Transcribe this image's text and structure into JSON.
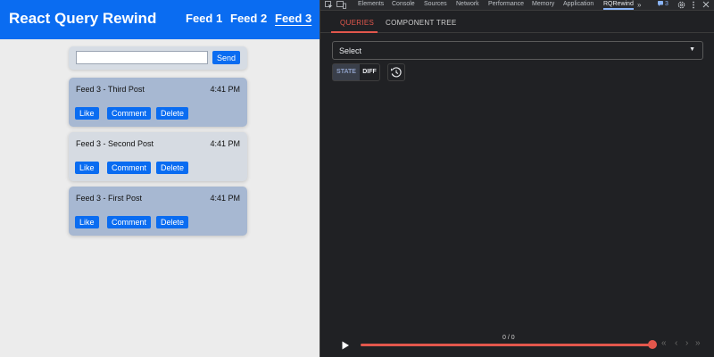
{
  "app": {
    "title": "React Query Rewind",
    "nav": [
      {
        "label": "Feed 1",
        "active": false
      },
      {
        "label": "Feed 2",
        "active": false
      },
      {
        "label": "Feed 3",
        "active": true
      }
    ],
    "composer": {
      "value": "",
      "send_label": "Send"
    },
    "posts": [
      {
        "title": "Feed 3 - Third Post",
        "time": "4:41 PM",
        "liked": true,
        "buttons": [
          "Like",
          "Comment",
          "Delete"
        ]
      },
      {
        "title": "Feed 3 - Second Post",
        "time": "4:41 PM",
        "liked": false,
        "buttons": [
          "Like",
          "Comment",
          "Delete"
        ]
      },
      {
        "title": "Feed 3 - First Post",
        "time": "4:41 PM",
        "liked": true,
        "buttons": [
          "Like",
          "Comment",
          "Delete"
        ]
      }
    ]
  },
  "devtools": {
    "tabs": [
      {
        "label": "Elements"
      },
      {
        "label": "Console"
      },
      {
        "label": "Sources"
      },
      {
        "label": "Network"
      },
      {
        "label": "Performance"
      },
      {
        "label": "Memory"
      },
      {
        "label": "Application"
      },
      {
        "label": "RQRewind",
        "active": true
      }
    ],
    "overflow_glyph": "»",
    "issues_count": "3",
    "icons": [
      "inspect-icon",
      "device-toggle-icon",
      "settings-icon",
      "more-icon",
      "close-icon"
    ]
  },
  "rqrewind": {
    "tabs": [
      {
        "label": "QUERIES",
        "active": true
      },
      {
        "label": "COMPONENT TREE",
        "active": false
      }
    ],
    "select": {
      "label": "Select"
    },
    "view_toggle": {
      "state_label": "STATE",
      "diff_label": "DIFF",
      "active": "STATE"
    },
    "history_icon": "history-icon",
    "timeline": {
      "counter": "0 / 0",
      "progress": 1.0
    }
  },
  "colors": {
    "app_header": "#0a6cf1",
    "button_blue": "#0a6cf1",
    "post_liked": "#a7b8d2",
    "post_plain": "#d6dbe2",
    "devtools_bg": "#202124",
    "accent_red": "#e2574c"
  }
}
